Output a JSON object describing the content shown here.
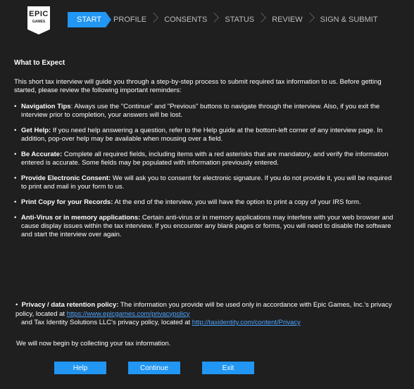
{
  "logo": {
    "line1": "EPIC",
    "line2": "GAMES"
  },
  "steps": [
    {
      "label": "START",
      "active": true
    },
    {
      "label": "PROFILE"
    },
    {
      "label": "CONSENTS"
    },
    {
      "label": "STATUS"
    },
    {
      "label": "REVIEW"
    },
    {
      "label": "SIGN & SUBMIT"
    }
  ],
  "content": {
    "title": "What to Expect",
    "intro": "This short tax interview will guide you through a step-by-step process to submit required tax information to us. Before getting started, please review the following important reminders:",
    "bullets": [
      {
        "heading": "Navigation Tips",
        "text": ": Always use the \"Continue\" and \"Previous\" buttons to navigate through the interview. Also, if you exit the interview prior to completion, your answers will be lost."
      },
      {
        "heading": "Get Help:",
        "text": " If you need help answering a question, refer to the Help guide at the bottom-left corner of any interview page. In addition, pop-over help may be available when mousing over a field."
      },
      {
        "heading": "Be Accurate:",
        "text": " Complete all required fields, including items with a red asterisks that are mandatory, and verify the information entered is accurate. Some fields may be populated with information previously entered."
      },
      {
        "heading": "Provide Electronic Consent:",
        "text": " We will ask you to consent for electronic signature. If you do not provide it, you will be required to print and mail in your form to us."
      },
      {
        "heading": "Print Copy for your Records:",
        "text": " At the end of the interview, you will have the option to print a copy of your IRS form."
      },
      {
        "heading": "Anti-Virus or in memory applications:",
        "text": "  Certain anti-virus or in memory applications may interfere with your web browser and cause display issues within the tax interview. If you encounter any blank pages or forms, you will need to disable the software and start the interview over again."
      }
    ],
    "privacy": {
      "heading": "Privacy / data retention policy:",
      "text1": " The information you provide will be used only in accordance with Epic Games, Inc.'s privacy policy, located at ",
      "link1": "https://www.epicgames.com/privacypolicy",
      "text2": "and Tax Identity Solutions LLC's privacy policy, located at ",
      "link2": "http://taxidentity.com/content/Privacy"
    },
    "closing": "We will now begin by collecting your tax information."
  },
  "buttons": {
    "help": "Help",
    "continue": "Continue",
    "exit": "Exit"
  },
  "colors": {
    "background": "#1f1f1f",
    "accent": "#2196f3",
    "link": "#4ea3ff"
  }
}
